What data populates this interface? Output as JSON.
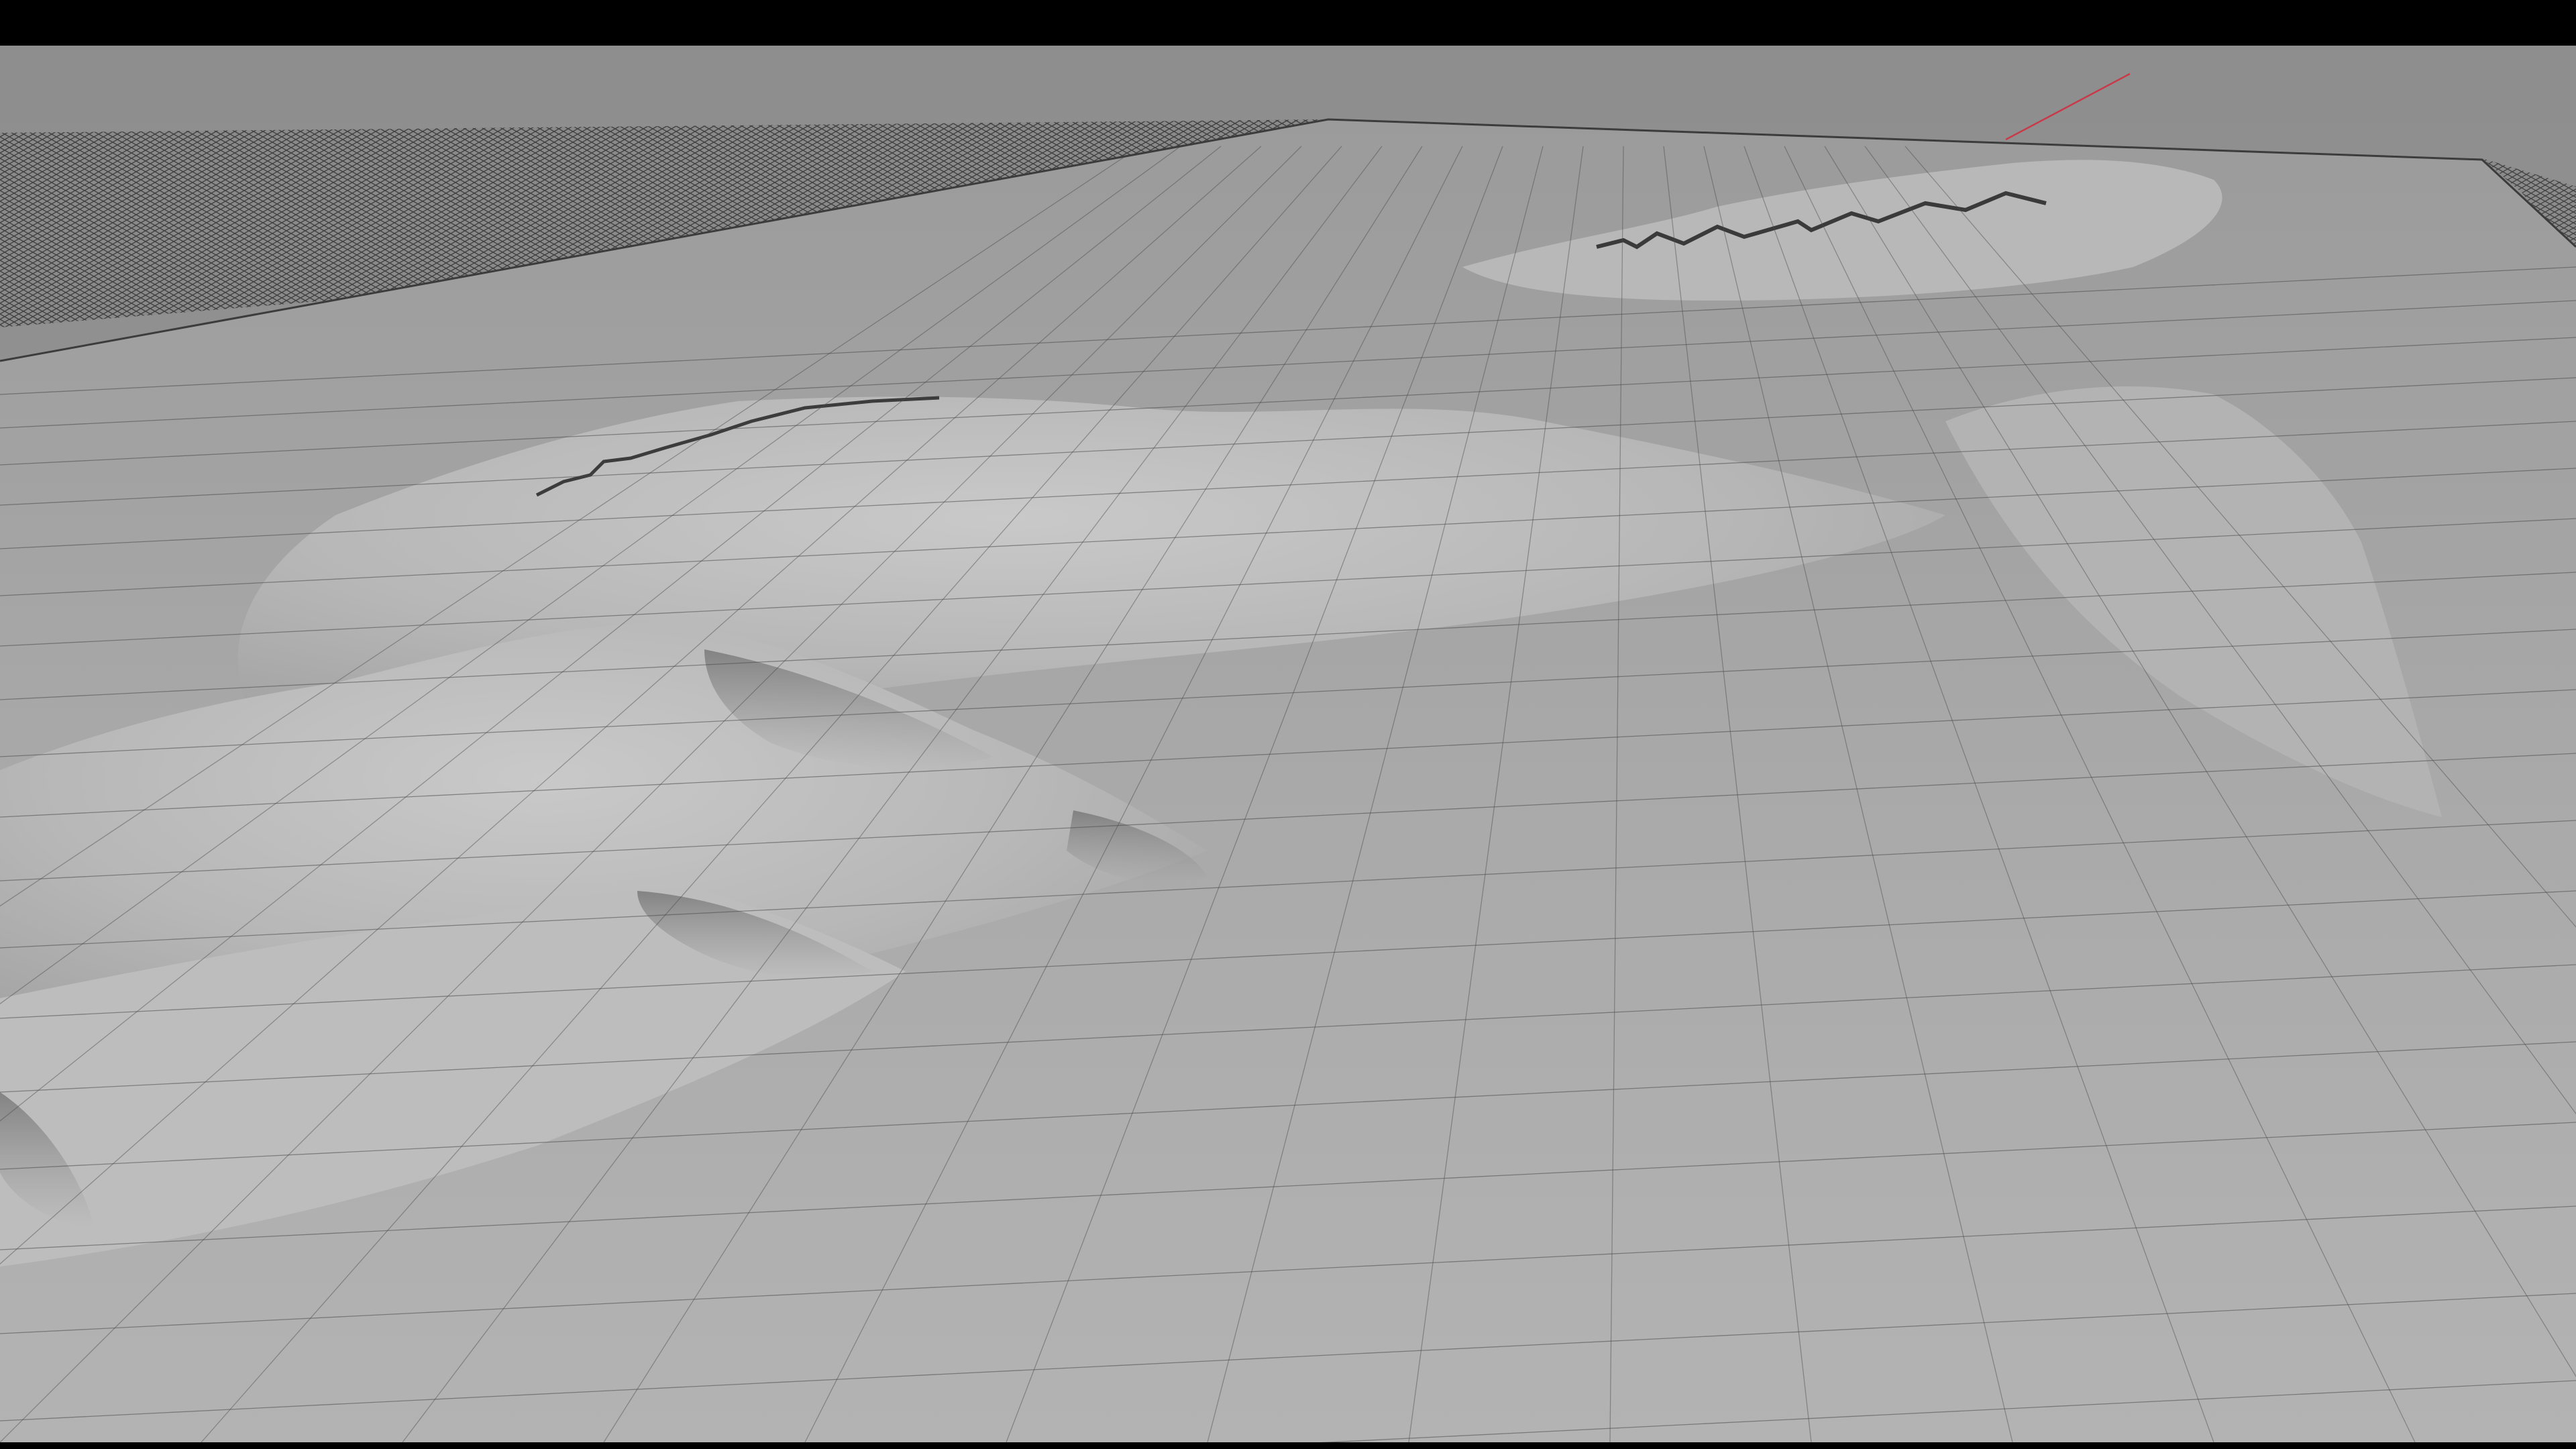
{
  "viewport": {
    "view": "perspective",
    "shading": "wireframe-on-shaded",
    "object": "terrain-mesh"
  },
  "colors": {
    "letterbox": "#000000",
    "background": "#8c8c8c",
    "terrain_light": "#bdbdbd",
    "terrain_mid": "#a6a6a6",
    "terrain_shadow": "#6f6f6f",
    "wire": "#4a4a4a",
    "axis_x": "#c83a4a"
  }
}
